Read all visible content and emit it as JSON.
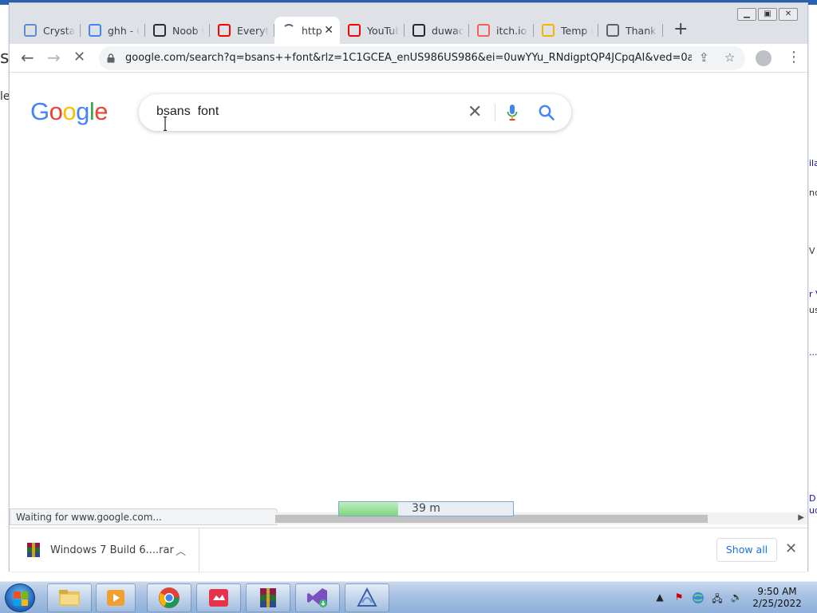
{
  "background_window": {
    "left_fragments": [
      "s",
      "le"
    ],
    "right_fragments": [
      "ila",
      "nc",
      "V",
      "r V",
      "us",
      "...",
      "D",
      "ud"
    ]
  },
  "window_controls": [
    "minimize",
    "maximize",
    "close"
  ],
  "tabs": [
    {
      "title": "Crystal",
      "icon": "crystal-icon",
      "color": "#5b8dd6"
    },
    {
      "title": "ghh - G",
      "icon": "google-icon",
      "color": "#4285f4"
    },
    {
      "title": "Noob v",
      "icon": "game-thumbnail-icon",
      "color": "#2b2b3a"
    },
    {
      "title": "Everyth",
      "icon": "youtube-icon",
      "color": "#ff0000"
    },
    {
      "title": "http",
      "icon": "loading-spinner-icon",
      "color": "#5f6368",
      "active": true
    },
    {
      "title": "YouTub",
      "icon": "youtube-icon",
      "color": "#ff0000"
    },
    {
      "title": "duwaca",
      "icon": "github-icon",
      "color": "#24292f"
    },
    {
      "title": "itch.io",
      "icon": "itchio-icon",
      "color": "#fa5c5c"
    },
    {
      "title": "Temp M",
      "icon": "tempmail-icon",
      "color": "#f4b400"
    },
    {
      "title": "Thank y",
      "icon": "globe-icon",
      "color": "#5f6368"
    }
  ],
  "toolbar": {
    "url": "google.com/search?q=bsans++font&rlz=1C1GCEA_enUS986US986&ei=0uwYYu_RNdigptQP4JCpqAI&ved=0ahU..."
  },
  "google": {
    "logo": [
      "G",
      "o",
      "o",
      "g",
      "l",
      "e"
    ],
    "logo_colors": [
      "#4285f4",
      "#ea4335",
      "#fbbc05",
      "#4285f4",
      "#34a853",
      "#ea4335"
    ],
    "query": "bsans  font"
  },
  "status": {
    "text": "Waiting for www.google.com...",
    "progress_label": "39 m",
    "progress_fraction": 0.34
  },
  "download": {
    "filename": "Windows 7 Build 6....rar",
    "show_all": "Show all"
  },
  "taskbar": {
    "apps": [
      "explorer-icon",
      "media-player-icon",
      "chrome-icon",
      "gamemaker-icon",
      "winrar-icon",
      "visual-studio-icon",
      "inkscape-icon"
    ],
    "clock_time": "9:50 AM",
    "clock_date": "2/25/2022"
  }
}
